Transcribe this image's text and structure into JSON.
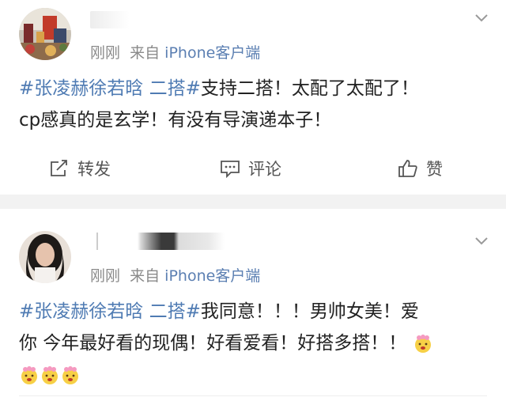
{
  "posts": [
    {
      "time": "刚刚",
      "from": "来自",
      "source": "iPhone客户端",
      "topic": "#张凌赫徐若晗 二搭#",
      "text_line1": "支持二搭！太配了太配了！",
      "text_line2": "cp感真的是玄学！有没有导演递本子！",
      "actions": {
        "repost": "转发",
        "comment": "评论",
        "like": "赞"
      }
    },
    {
      "time": "刚刚",
      "from": "来自",
      "source": "iPhone客户端",
      "topic": "#张凌赫徐若晗 二搭#",
      "text_line1": "我同意！！！男帅女美！爱",
      "text_line2": "你 今年最好看的现偶！好看爱看！好搭多搭！！",
      "emoji": "flower-face-emoji"
    }
  ],
  "colors": {
    "topic": "#4f7bb3",
    "source": "#5b7fb2",
    "meta": "#8a8a8a",
    "separator": "#f2f2f2"
  }
}
